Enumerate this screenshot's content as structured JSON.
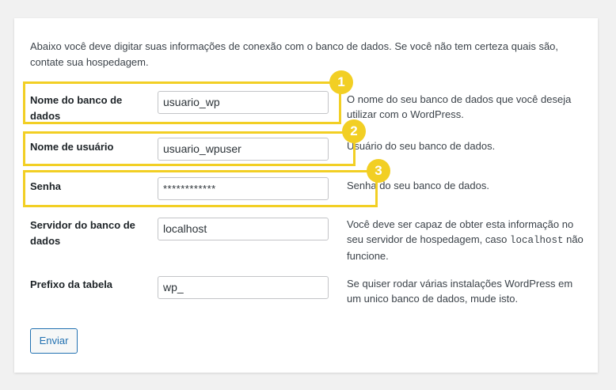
{
  "intro": "Abaixo você deve digitar suas informações de conexão com o banco de dados. Se você não tem certeza quais são, contate sua hospedagem.",
  "fields": {
    "dbname": {
      "label": "Nome do banco de dados",
      "value": "usuario_wp",
      "description": "O nome do seu banco de dados que você deseja utilizar com o WordPress."
    },
    "uname": {
      "label": "Nome de usuário",
      "value": "usuario_wpuser",
      "description": "Usuário do seu banco de dados."
    },
    "pwd": {
      "label": "Senha",
      "value": "************",
      "description": "Senha do seu banco de dados."
    },
    "dbhost": {
      "label": "Servidor do banco de dados",
      "value": "localhost",
      "description_before": "Você deve ser capaz de obter esta informação no seu servidor de hospedagem, caso ",
      "description_code": "localhost",
      "description_after": " não funcione."
    },
    "prefix": {
      "label": "Prefixo da tabela",
      "value": "wp_",
      "description": "Se quiser rodar várias instalações WordPress em um unico banco de dados, mude isto."
    }
  },
  "annotations": [
    "1",
    "2",
    "3"
  ],
  "submit_label": "Enviar",
  "colors": {
    "highlight": "#f2cf24",
    "button_accent": "#2271b1",
    "background": "#f1f1f1"
  }
}
